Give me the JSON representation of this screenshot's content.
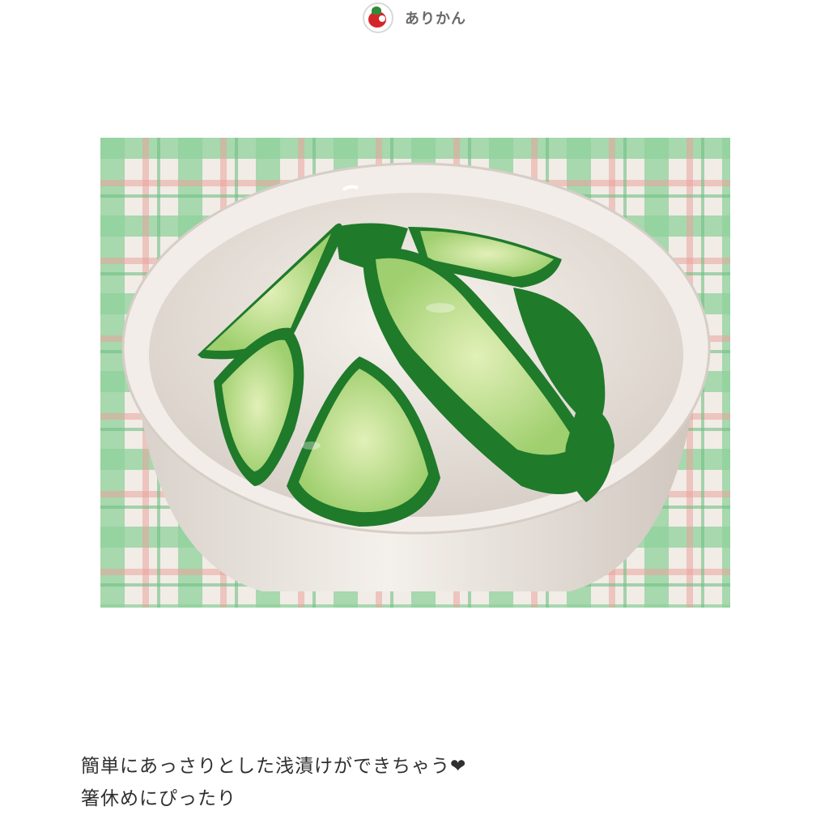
{
  "author": {
    "name": "ありかん",
    "avatar_icon": "tomato-avatar-icon"
  },
  "photo": {
    "subject": "cucumber-pickles-in-white-bowl",
    "colors": {
      "tablecloth_green": "#6fbf84",
      "tablecloth_pink": "#e9a9a0",
      "bowl": "#efe9e3",
      "cucumber_skin": "#1f7a2a",
      "cucumber_flesh": "#c9e3a2"
    }
  },
  "caption": {
    "line1": "簡単にあっさりとした浅漬けができちゃう❤",
    "line2": "箸休めにぴったり"
  }
}
